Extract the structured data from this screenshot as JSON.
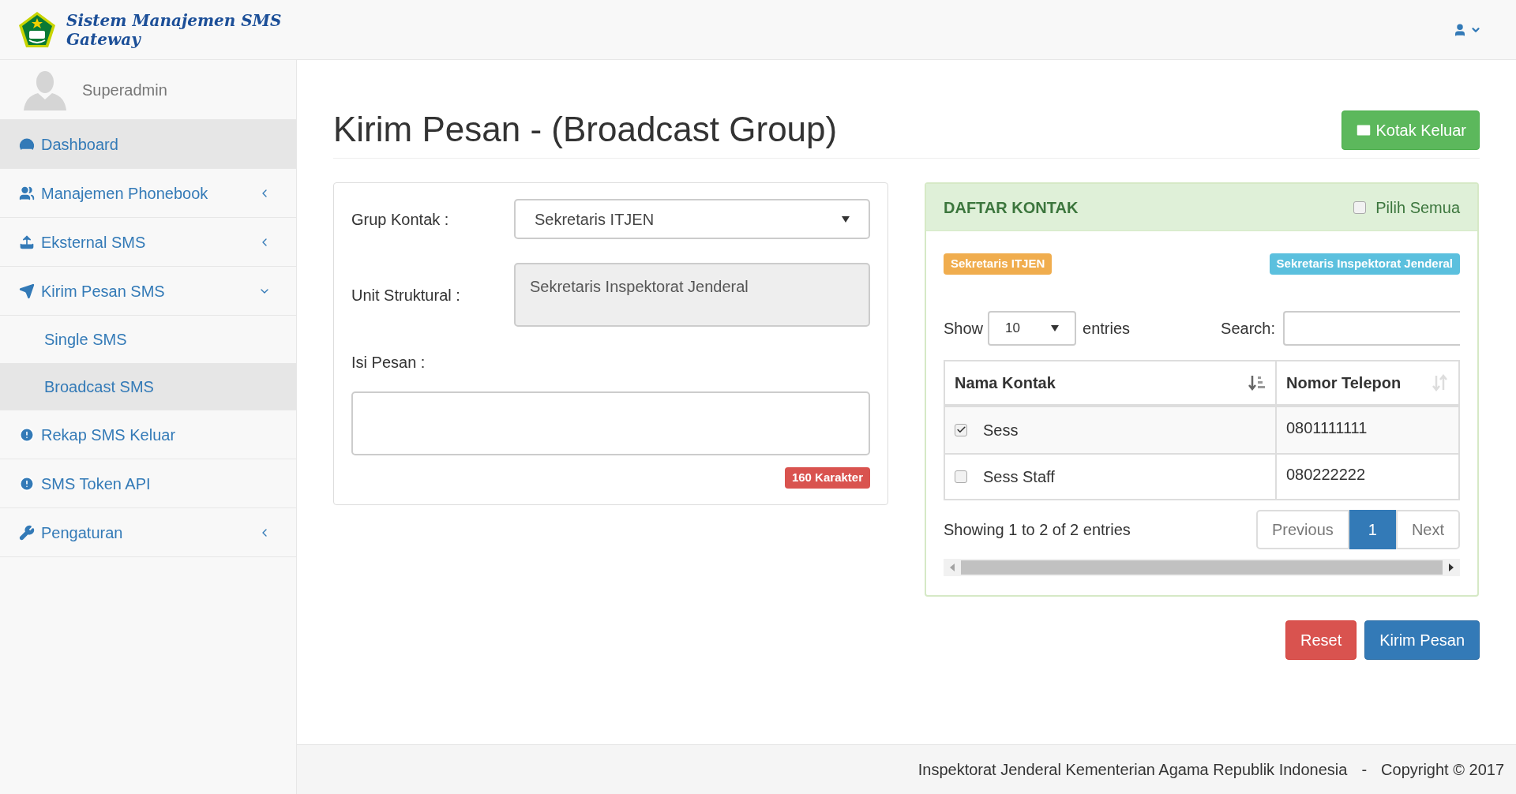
{
  "header": {
    "app_title": "Sistem Manajemen SMS Gateway"
  },
  "sidebar": {
    "user": "Superadmin",
    "items": [
      {
        "label": "Dashboard",
        "selected": true
      },
      {
        "label": "Manajemen Phonebook",
        "selected": false,
        "expanded": false
      },
      {
        "label": "Eksternal SMS",
        "selected": false,
        "expanded": false
      },
      {
        "label": "Kirim Pesan SMS",
        "selected": false,
        "expanded": true,
        "children": [
          {
            "label": "Single SMS",
            "selected": false
          },
          {
            "label": "Broadcast SMS",
            "selected": true
          }
        ]
      },
      {
        "label": "Rekap SMS Keluar",
        "selected": false
      },
      {
        "label": "SMS Token API",
        "selected": false
      },
      {
        "label": "Pengaturan",
        "selected": false,
        "expanded": false
      }
    ]
  },
  "page": {
    "title": "Kirim Pesan - (Broadcast Group)",
    "outbox_button": "Kotak Keluar"
  },
  "form": {
    "group_label": "Grup Kontak :",
    "group_value": "Sekretaris ITJEN",
    "unit_label": "Unit Struktural :",
    "unit_value": "Sekretaris Inspektorat Jenderal",
    "message_label": "Isi Pesan :",
    "char_badge": "160 Karakter"
  },
  "contacts": {
    "title": "DAFTAR KONTAK",
    "select_all": {
      "label": "Pilih Semua",
      "checked": false
    },
    "badges": [
      {
        "label": "Sekretaris ITJEN",
        "color": "#f0ad4e"
      },
      {
        "label": "Sekretaris Inspektorat Jenderal",
        "color": "#5bc0de"
      }
    ],
    "show_label": "Show",
    "page_size": "10",
    "entries_label": "entries",
    "search_label": "Search:",
    "columns": [
      {
        "label": "Nama Kontak",
        "sorted": true
      },
      {
        "label": "Nomor Telepon",
        "sorted": false
      }
    ],
    "rows": [
      {
        "name": "Sess",
        "phone": "0801111111",
        "checked": true
      },
      {
        "name": "Sess Staff",
        "phone": "080222222",
        "checked": false
      }
    ],
    "info": "Showing 1 to 2 of 2 entries",
    "pagination": [
      {
        "label": "Previous",
        "selected": false
      },
      {
        "label": "1",
        "selected": true
      },
      {
        "label": "Next",
        "selected": false
      }
    ]
  },
  "actions": [
    {
      "label": "Reset",
      "kind": "danger"
    },
    {
      "label": "Kirim Pesan",
      "kind": "primary"
    }
  ],
  "footer": {
    "organization": "Inspektorat Jenderal Kementerian Agama Republik Indonesia",
    "separator": "-",
    "copyright": "Copyright © 2017"
  }
}
